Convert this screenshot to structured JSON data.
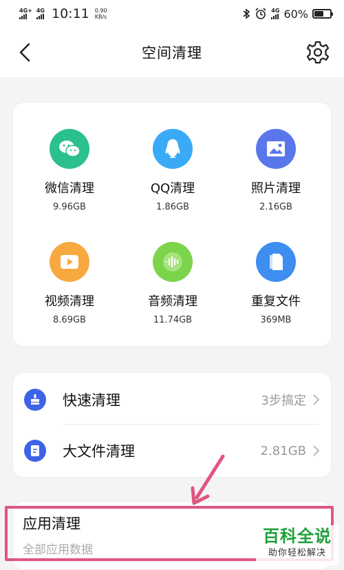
{
  "status_bar": {
    "network1": "4G+",
    "network2": "4G",
    "time": "10:11",
    "speed_value": "0.90",
    "speed_unit": "KB/s",
    "network3": "4G",
    "battery": "60%",
    "battery_level": 0.6
  },
  "header": {
    "title": "空间清理",
    "back_icon": "chevron-left-icon",
    "settings_icon": "gear-icon"
  },
  "categories": [
    {
      "name": "微信清理",
      "size": "9.96GB",
      "icon": "wechat-icon",
      "color": "#2bc08d"
    },
    {
      "name": "QQ清理",
      "size": "1.86GB",
      "icon": "qq-penguin-icon",
      "color": "#3aa9f6"
    },
    {
      "name": "照片清理",
      "size": "2.16GB",
      "icon": "image-icon",
      "color": "#5a76ec"
    },
    {
      "name": "视频清理",
      "size": "8.69GB",
      "icon": "video-play-icon",
      "color": "#f7a940"
    },
    {
      "name": "音频清理",
      "size": "11.74GB",
      "icon": "audio-wave-icon",
      "color": "#7bd449"
    },
    {
      "name": "重复文件",
      "size": "369MB",
      "icon": "duplicate-file-icon",
      "color": "#3d8ef0"
    }
  ],
  "list": [
    {
      "label": "快速清理",
      "value": "3步搞定",
      "icon": "broom-icon"
    },
    {
      "label": "大文件清理",
      "value": "2.81GB",
      "icon": "document-icon"
    }
  ],
  "app_clean": {
    "title": "应用清理",
    "subtitle": "全部应用数据"
  },
  "watermark": {
    "title": "百科全说",
    "subtitle": "助你轻松解决"
  },
  "colors": {
    "accent_blue": "#3d63e6",
    "highlight_pink": "#e0567f",
    "watermark_green": "#1fa03a"
  }
}
